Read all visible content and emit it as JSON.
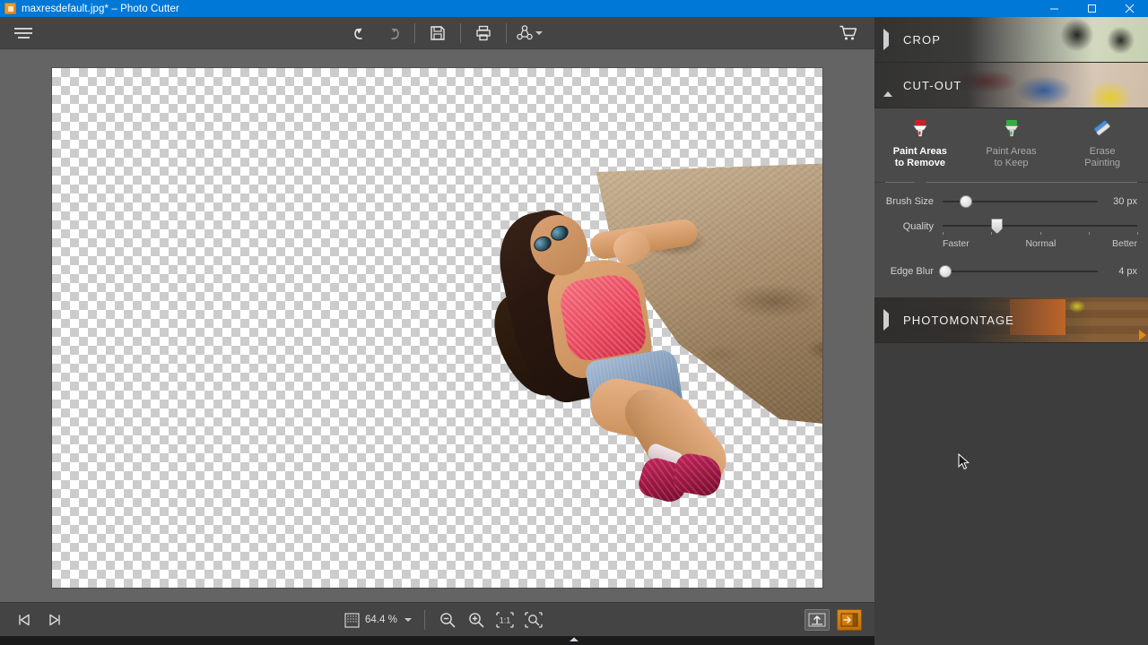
{
  "window": {
    "title": "maxresdefault.jpg* – Photo Cutter",
    "app_icon": "photo-cutter-icon",
    "minimize_label": "Minimize",
    "maximize_label": "Restore",
    "close_label": "Close"
  },
  "toolbar": {
    "menu_label": "Menu",
    "undo_label": "Undo",
    "redo_label": "Redo",
    "save_label": "Save",
    "print_label": "Print",
    "share_label": "Share",
    "cart_label": "Shop"
  },
  "canvas": {
    "background": "transparent-checkerboard",
    "image_name": "maxresdefault.jpg"
  },
  "bottombar": {
    "first_image_label": "First Image",
    "next_image_label": "Next Image",
    "zoom_icon_label": "Zoom Level",
    "zoom_value": "64.4 %",
    "zoom_out_label": "Zoom Out",
    "zoom_in_label": "Zoom In",
    "actual_size_label": "1:1",
    "fit_screen_label": "Fit to Screen",
    "export_label": "Export",
    "panel_toggle_label": "Toggle Panel"
  },
  "panel": {
    "sections": [
      {
        "label": "CROP",
        "expanded": false
      },
      {
        "label": "CUT-OUT",
        "expanded": true
      },
      {
        "label": "PHOTOMONTAGE",
        "expanded": false
      }
    ],
    "cutout": {
      "tools": [
        {
          "name": "paint-remove",
          "line1": "Paint Areas",
          "line2": "to Remove",
          "icon": "red-marker-icon",
          "active": true
        },
        {
          "name": "paint-keep",
          "line1": "Paint Areas",
          "line2": "to Keep",
          "icon": "green-marker-icon",
          "active": false
        },
        {
          "name": "erase-painting",
          "line1": "Erase",
          "line2": "Painting",
          "icon": "blue-eraser-icon",
          "active": false
        }
      ],
      "brush_size": {
        "label": "Brush Size",
        "value": "30 px",
        "percent": 15
      },
      "quality": {
        "label": "Quality",
        "percent": 28,
        "ticks": [
          {
            "label": "Faster",
            "percent": 0
          },
          {
            "label": "Normal",
            "percent": 50
          },
          {
            "label": "Better",
            "percent": 100
          }
        ]
      },
      "edge_blur": {
        "label": "Edge Blur",
        "value": "4 px",
        "percent": 2
      }
    },
    "collapse_arrow_label": "Collapse Panel"
  },
  "colors": {
    "title_bar": "#0078d7",
    "toolbar": "#444444",
    "panel": "#4a4a4a",
    "workspace": "#646464",
    "accent_orange": "#e08a18",
    "marker_red": "#d0202a",
    "marker_green": "#2fae3c",
    "eraser_blue": "#3b78d8"
  }
}
